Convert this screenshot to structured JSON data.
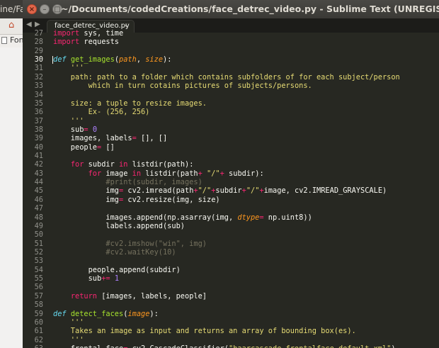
{
  "background_app": {
    "title_fragment": "ine/Fac",
    "bookmark_fragment": "Fon"
  },
  "window": {
    "title": "~/Documents/codedCreations/face_detrec_video.py - Sublime Text (UNREGISTERED)",
    "buttons": {
      "close": "×",
      "minimize": "–",
      "maximize": "□"
    }
  },
  "tabs": {
    "nav_left": "◀",
    "nav_right": "▶",
    "active_tab": {
      "label": "face_detrec_video.py",
      "close": "×"
    }
  },
  "editor": {
    "active_line": 30,
    "lines": [
      {
        "n": "27",
        "tokens": [
          {
            "t": "import",
            "c": "kw"
          },
          {
            "t": " sys, time",
            "c": ""
          }
        ]
      },
      {
        "n": "28",
        "tokens": [
          {
            "t": "import",
            "c": "kw"
          },
          {
            "t": " requests",
            "c": ""
          }
        ]
      },
      {
        "n": "29",
        "tokens": []
      },
      {
        "n": "30",
        "tokens": [
          {
            "t": "def",
            "c": "def"
          },
          {
            "t": " ",
            "c": ""
          },
          {
            "t": "get_images",
            "c": "fn"
          },
          {
            "t": "(",
            "c": ""
          },
          {
            "t": "path",
            "c": "prm"
          },
          {
            "t": ", ",
            "c": ""
          },
          {
            "t": "size",
            "c": "prm"
          },
          {
            "t": "):",
            "c": ""
          }
        ]
      },
      {
        "n": "31",
        "tokens": [
          {
            "t": "    '''",
            "c": "str"
          }
        ]
      },
      {
        "n": "32",
        "tokens": [
          {
            "t": "    path: path to a folder which contains subfolders of for each subject/person",
            "c": "str"
          }
        ]
      },
      {
        "n": "33",
        "tokens": [
          {
            "t": "        which in turn cotains pictures of subjects/persons.",
            "c": "str"
          }
        ]
      },
      {
        "n": "34",
        "tokens": []
      },
      {
        "n": "35",
        "tokens": [
          {
            "t": "    size: a tuple to resize images.",
            "c": "str"
          }
        ]
      },
      {
        "n": "36",
        "tokens": [
          {
            "t": "        Ex- (256, 256)",
            "c": "str"
          }
        ]
      },
      {
        "n": "37",
        "tokens": [
          {
            "t": "    '''",
            "c": "str"
          }
        ]
      },
      {
        "n": "38",
        "tokens": [
          {
            "t": "    sub",
            "c": ""
          },
          {
            "t": "=",
            "c": "kw"
          },
          {
            "t": " ",
            "c": ""
          },
          {
            "t": "0",
            "c": "num"
          }
        ]
      },
      {
        "n": "39",
        "tokens": [
          {
            "t": "    images, labels",
            "c": ""
          },
          {
            "t": "=",
            "c": "kw"
          },
          {
            "t": " [], []",
            "c": ""
          }
        ]
      },
      {
        "n": "40",
        "tokens": [
          {
            "t": "    people",
            "c": ""
          },
          {
            "t": "=",
            "c": "kw"
          },
          {
            "t": " []",
            "c": ""
          }
        ]
      },
      {
        "n": "41",
        "tokens": []
      },
      {
        "n": "42",
        "tokens": [
          {
            "t": "    ",
            "c": ""
          },
          {
            "t": "for",
            "c": "kw"
          },
          {
            "t": " subdir ",
            "c": ""
          },
          {
            "t": "in",
            "c": "kw"
          },
          {
            "t": " listdir(path):",
            "c": ""
          }
        ]
      },
      {
        "n": "43",
        "tokens": [
          {
            "t": "        ",
            "c": ""
          },
          {
            "t": "for",
            "c": "kw"
          },
          {
            "t": " image ",
            "c": ""
          },
          {
            "t": "in",
            "c": "kw"
          },
          {
            "t": " listdir(path",
            "c": ""
          },
          {
            "t": "+",
            "c": "kw"
          },
          {
            "t": " ",
            "c": ""
          },
          {
            "t": "\"/\"",
            "c": "str"
          },
          {
            "t": "+",
            "c": "kw"
          },
          {
            "t": " subdir):",
            "c": ""
          }
        ]
      },
      {
        "n": "44",
        "tokens": [
          {
            "t": "            #print(subdir, images)",
            "c": "cmt"
          }
        ]
      },
      {
        "n": "45",
        "tokens": [
          {
            "t": "            img",
            "c": ""
          },
          {
            "t": "=",
            "c": "kw"
          },
          {
            "t": " cv2.imread(path",
            "c": ""
          },
          {
            "t": "+",
            "c": "kw"
          },
          {
            "t": "\"/\"",
            "c": "str"
          },
          {
            "t": "+",
            "c": "kw"
          },
          {
            "t": "subdir",
            "c": ""
          },
          {
            "t": "+",
            "c": "kw"
          },
          {
            "t": "\"/\"",
            "c": "str"
          },
          {
            "t": "+",
            "c": "kw"
          },
          {
            "t": "image, cv2.IMREAD_GRAYSCALE)",
            "c": ""
          }
        ]
      },
      {
        "n": "46",
        "tokens": [
          {
            "t": "            img",
            "c": ""
          },
          {
            "t": "=",
            "c": "kw"
          },
          {
            "t": " cv2.resize(img, size)",
            "c": ""
          }
        ]
      },
      {
        "n": "47",
        "tokens": []
      },
      {
        "n": "48",
        "tokens": [
          {
            "t": "            images.append(np.asarray(img, ",
            "c": ""
          },
          {
            "t": "dtype",
            "c": "prm"
          },
          {
            "t": "=",
            "c": "kw"
          },
          {
            "t": " np.uint8))",
            "c": ""
          }
        ]
      },
      {
        "n": "49",
        "tokens": [
          {
            "t": "            labels.append(sub)",
            "c": ""
          }
        ]
      },
      {
        "n": "50",
        "tokens": []
      },
      {
        "n": "51",
        "tokens": [
          {
            "t": "            #cv2.imshow(\"win\", img)",
            "c": "cmt"
          }
        ]
      },
      {
        "n": "52",
        "tokens": [
          {
            "t": "            #cv2.waitKey(10)",
            "c": "cmt"
          }
        ]
      },
      {
        "n": "53",
        "tokens": []
      },
      {
        "n": "54",
        "tokens": [
          {
            "t": "        people.append(subdir)",
            "c": ""
          }
        ]
      },
      {
        "n": "55",
        "tokens": [
          {
            "t": "        sub",
            "c": ""
          },
          {
            "t": "+=",
            "c": "kw"
          },
          {
            "t": " ",
            "c": ""
          },
          {
            "t": "1",
            "c": "num"
          }
        ]
      },
      {
        "n": "56",
        "tokens": []
      },
      {
        "n": "57",
        "tokens": [
          {
            "t": "    ",
            "c": ""
          },
          {
            "t": "return",
            "c": "kw"
          },
          {
            "t": " [images, labels, people]",
            "c": ""
          }
        ]
      },
      {
        "n": "58",
        "tokens": []
      },
      {
        "n": "59",
        "tokens": [
          {
            "t": "def",
            "c": "def"
          },
          {
            "t": " ",
            "c": ""
          },
          {
            "t": "detect_faces",
            "c": "fn"
          },
          {
            "t": "(",
            "c": ""
          },
          {
            "t": "image",
            "c": "prm"
          },
          {
            "t": "):",
            "c": ""
          }
        ]
      },
      {
        "n": "60",
        "tokens": [
          {
            "t": "    '''",
            "c": "str"
          }
        ]
      },
      {
        "n": "61",
        "tokens": [
          {
            "t": "    Takes an image as input and returns an array of bounding box(es).",
            "c": "str"
          }
        ]
      },
      {
        "n": "62",
        "tokens": [
          {
            "t": "    '''",
            "c": "str"
          }
        ]
      },
      {
        "n": "63",
        "tokens": [
          {
            "t": "    frontal_face",
            "c": ""
          },
          {
            "t": "=",
            "c": "kw"
          },
          {
            "t": " cv2.CascadeClassifier(",
            "c": ""
          },
          {
            "t": "\"haarcascade_frontalface_default.xml\"",
            "c": "str"
          },
          {
            "t": ")",
            "c": ""
          }
        ]
      }
    ]
  }
}
